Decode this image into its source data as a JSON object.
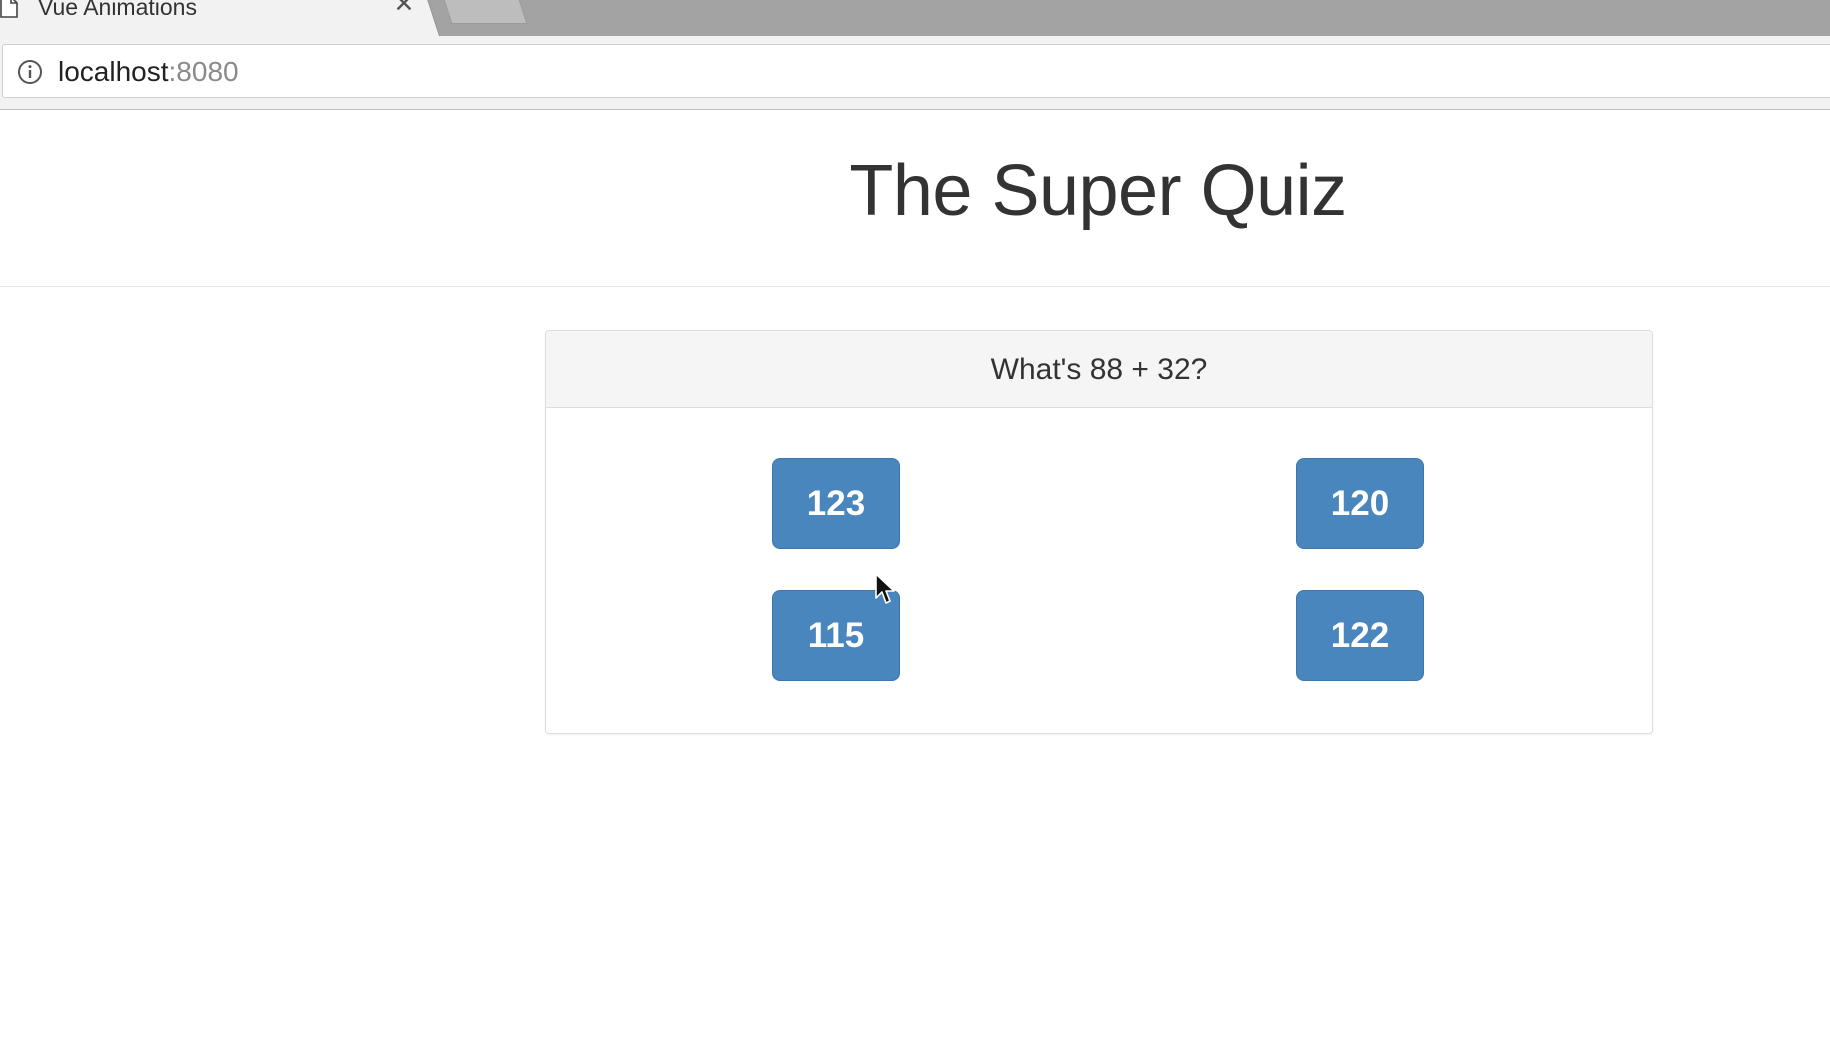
{
  "browser": {
    "tab_title": "Vue Animations",
    "tab_close": "✕",
    "url_host": "localhost",
    "url_port": ":8080",
    "icons": {
      "tab": "page-icon",
      "close": "close-icon",
      "info": "info-icon",
      "cursor": "cursor-icon"
    }
  },
  "page": {
    "title": "The Super Quiz",
    "question": "What's 88 + 32?",
    "answers": [
      "123",
      "120",
      "115",
      "122"
    ],
    "colors": {
      "button": "#4a86be",
      "title": "#333333"
    }
  }
}
